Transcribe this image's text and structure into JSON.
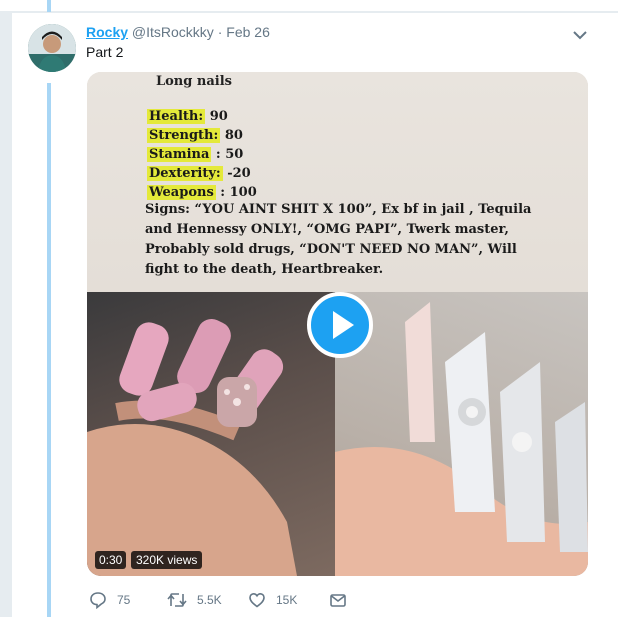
{
  "tweet": {
    "display_name": "Rocky",
    "handle": "@ItsRockkky",
    "separator": "·",
    "date": "Feb 26",
    "text": "Part 2"
  },
  "media": {
    "paper_title": "Long nails",
    "stats": [
      {
        "label": "Health:",
        "value": " 90"
      },
      {
        "label": "Strength:",
        "value": " 80"
      },
      {
        "label": "Stamina",
        "value": " : 50"
      },
      {
        "label": "Dexterity:",
        "value": " -20"
      },
      {
        "label": "Weapons",
        "value": " : 100"
      }
    ],
    "signs_lines": [
      "Signs: “YOU AINT SHIT X 100”, Ex bf in jail , Tequila",
      "and Hennessy ONLY!, “OMG PAPI”, Twerk master,",
      "Probably sold drugs, “DON'T NEED NO MAN”, Will",
      "fight to the death, Heartbreaker."
    ],
    "duration": "0:30",
    "views": "320K views"
  },
  "actions": {
    "reply_count": "75",
    "retweet_count": "5.5K",
    "like_count": "15K"
  },
  "colors": {
    "accent": "#1da1f2",
    "muted": "#657786",
    "thread_line": "#a8d6f5",
    "highlight": "#e4e93a"
  },
  "icons": {
    "reply": "reply-icon",
    "retweet": "retweet-icon",
    "like": "heart-icon",
    "dm": "envelope-icon",
    "play": "play-icon",
    "caret": "chevron-down-icon"
  }
}
